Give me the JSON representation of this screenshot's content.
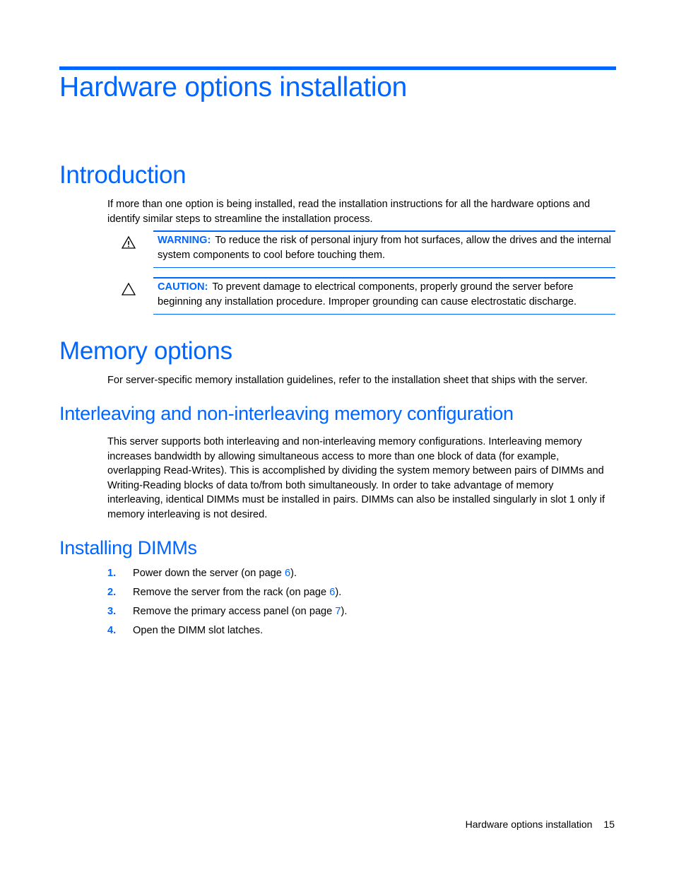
{
  "chapter_title": "Hardware options installation",
  "introduction": {
    "heading": "Introduction",
    "body": "If more than one option is being installed, read the installation instructions for all the hardware options and identify similar steps to streamline the installation process.",
    "warning": {
      "icon": "warning-icon",
      "label": "WARNING:",
      "text": "To reduce the risk of personal injury from hot surfaces, allow the drives and the internal system components to cool before touching them."
    },
    "caution": {
      "icon": "caution-icon",
      "label": "CAUTION:",
      "text": "To prevent damage to electrical components, properly ground the server before beginning any installation procedure. Improper grounding can cause electrostatic discharge."
    }
  },
  "memory_options": {
    "heading": "Memory options",
    "body": "For server-specific memory installation guidelines, refer to the installation sheet that ships with the server."
  },
  "interleaving": {
    "heading": "Interleaving and non-interleaving memory configuration",
    "body": "This server supports both interleaving and non-interleaving memory configurations. Interleaving memory increases bandwidth by allowing simultaneous access to more than one block of data (for example, overlapping Read-Writes). This is accomplished by dividing the system memory between pairs of DIMMs and Writing-Reading blocks of data to/from both simultaneously. In order to take advantage of memory interleaving, identical DIMMs must be installed in pairs. DIMMs can also be installed singularly in slot 1 only if memory interleaving is not desired."
  },
  "installing_dimms": {
    "heading": "Installing DIMMs",
    "steps": [
      {
        "num": "1.",
        "text": "Power down the server (on page ",
        "link": "6",
        "suffix": ")."
      },
      {
        "num": "2.",
        "text": "Remove the server from the rack (on page ",
        "link": "6",
        "suffix": ")."
      },
      {
        "num": "3.",
        "text": "Remove the primary access panel (on page ",
        "link": "7",
        "suffix": ")."
      },
      {
        "num": "4.",
        "text": "Open the DIMM slot latches.",
        "link": null,
        "suffix": ""
      }
    ]
  },
  "footer": {
    "section": "Hardware options installation",
    "page": "15"
  },
  "colors": {
    "accent": "#0066ff",
    "text": "#000000"
  }
}
